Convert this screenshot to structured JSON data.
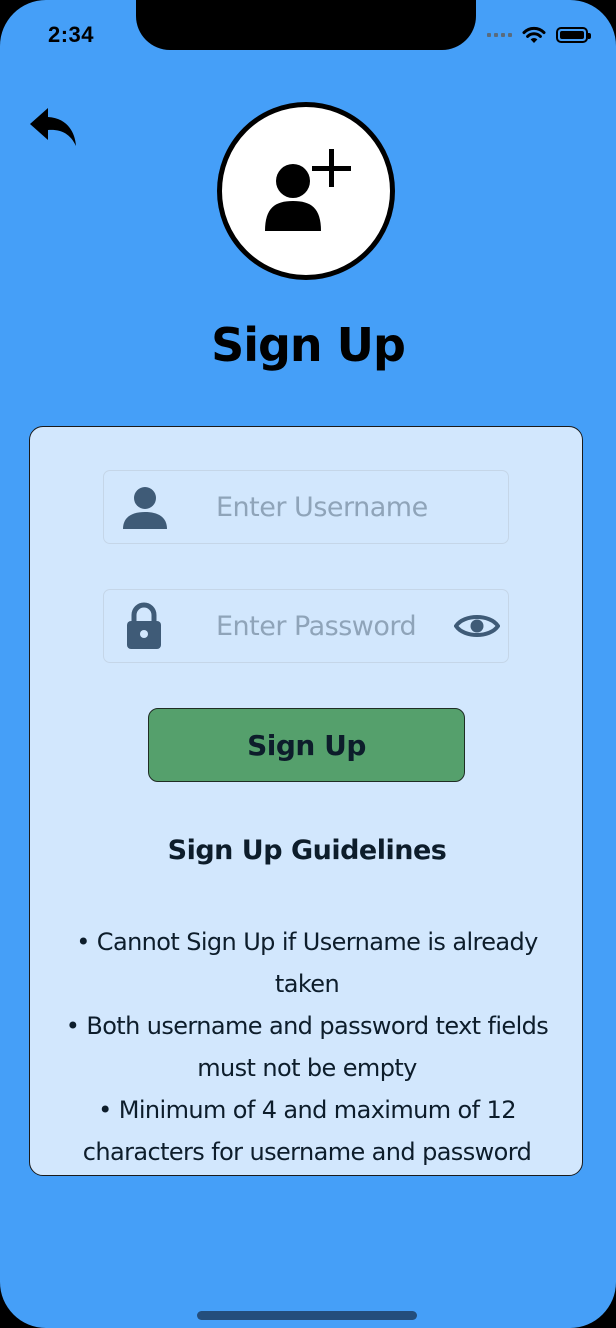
{
  "status_bar": {
    "time": "2:34"
  },
  "header": {
    "title": "Sign Up"
  },
  "form": {
    "username": {
      "placeholder": "Enter Username",
      "value": ""
    },
    "password": {
      "placeholder": "Enter Password",
      "value": ""
    },
    "submit_label": "Sign Up"
  },
  "guidelines": {
    "title": "Sign Up Guidelines",
    "items": [
      "• Cannot Sign Up if Username is already taken",
      "• Both username and password text fields must not be empty",
      "• Minimum of 4 and maximum of 12 characters for username and password"
    ]
  },
  "icons": {
    "back": "back-arrow-icon",
    "avatar": "add-user-icon",
    "username": "user-icon",
    "password": "lock-icon",
    "visibility": "eye-icon"
  },
  "colors": {
    "background": "#459ff8",
    "card": "#d2e7fd",
    "button": "#55a06c",
    "icon": "#3f5b77"
  }
}
